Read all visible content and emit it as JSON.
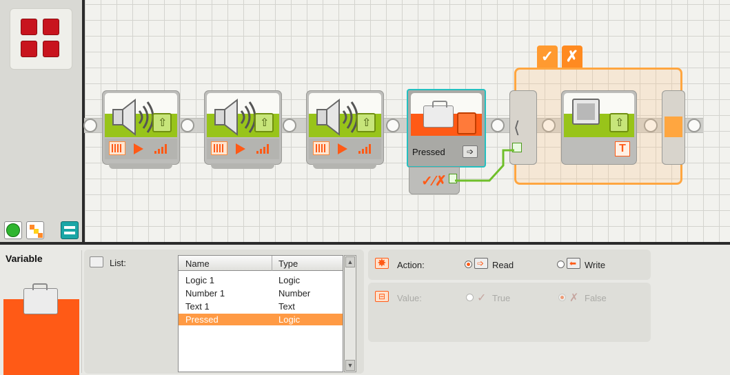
{
  "palette": {
    "tabs": [
      "common-palette",
      "complete-palette",
      "custom-palette"
    ]
  },
  "canvas": {
    "variable_block": {
      "label": "Pressed"
    },
    "switch": {
      "true_tab": "✓",
      "false_tab": "✗"
    },
    "display_block": {
      "text_icon": "T"
    }
  },
  "config": {
    "title": "Variable",
    "list": {
      "label": "List:",
      "columns": [
        "Name",
        "Type"
      ],
      "rows": [
        {
          "name": "Logic 1",
          "type": "Logic"
        },
        {
          "name": "Number 1",
          "type": "Number"
        },
        {
          "name": "Text 1",
          "type": "Text"
        },
        {
          "name": "Pressed",
          "type": "Logic",
          "selected": true
        }
      ]
    },
    "action": {
      "label": "Action:",
      "options": [
        {
          "label": "Read",
          "selected": true
        },
        {
          "label": "Write",
          "selected": false
        }
      ]
    },
    "value": {
      "label": "Value:",
      "options": [
        {
          "label": "True",
          "selected": false
        },
        {
          "label": "False",
          "selected": true
        }
      ]
    }
  },
  "colors": {
    "accent_orange": "#ff5a16",
    "switch_orange": "#ffa640",
    "selection": "#23c0c0",
    "action_green": "#98c41a",
    "brand_red": "#c8141e"
  }
}
